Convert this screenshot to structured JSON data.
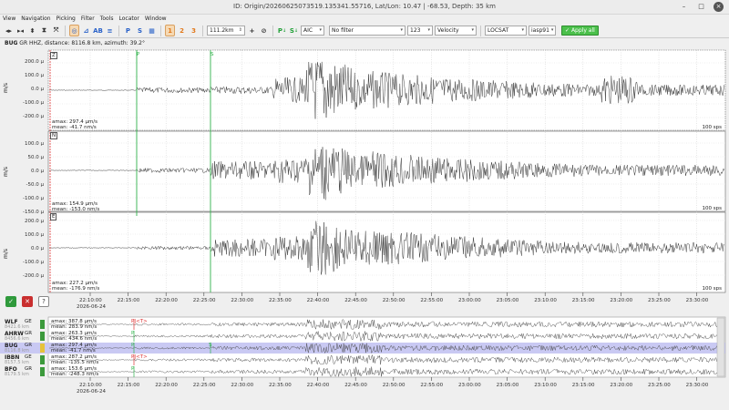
{
  "window": {
    "title": "ID: Origin/20260625073519.135341.55716, Lat/Lon: 10.47 | -68.53, Depth: 35 km"
  },
  "menu": [
    "View",
    "Navigation",
    "Picking",
    "Filter",
    "Tools",
    "Locator",
    "Window"
  ],
  "toolbar": {
    "distance": "111.2km",
    "picker": "AIC",
    "filter": "No filter",
    "components": "123",
    "unit": "Velocity",
    "locator": "LOCSAT",
    "profile": "iasp91",
    "apply": "Apply all",
    "pick_p": "P",
    "pick_s": "S",
    "comp_z": "1",
    "comp_n": "2",
    "comp_e": "3",
    "ab_label": "AB",
    "plus": "+"
  },
  "station_info": {
    "code": "BUG",
    "rest": "GR  HHZ, distance: 8116.8 km, azimuth: 39.2°"
  },
  "traces": [
    {
      "comp": "Z",
      "amax": "amax: 297.4 µm/s",
      "mean": "mean: -41.7 nm/s",
      "sps": "100 sps",
      "ticks": [
        "200.0 µ",
        "100.0 µ",
        "0.0 µ",
        "-100.0 µ",
        "-200.0 µ"
      ],
      "unit": "m/s"
    },
    {
      "comp": "N",
      "amax": "amax: 154.9 µm/s",
      "mean": "mean: -153.0 nm/s",
      "sps": "100 sps",
      "ticks": [
        "100.0 µ",
        "50.0 µ",
        "0.0 µ",
        "-50.0 µ",
        "-100.0 µ",
        "-150.0 µ"
      ],
      "unit": "m/s"
    },
    {
      "comp": "E",
      "amax": "amax: 227.2 µm/s",
      "mean": "mean: -176.9 nm/s",
      "sps": "100 sps",
      "ticks": [
        "200.0 µ",
        "100.0 µ",
        "0.0 µ",
        "-100.0 µ",
        "-200.0 µ"
      ],
      "unit": "m/s"
    }
  ],
  "time_axis": {
    "labels": [
      "22:10:00",
      "22:15:00",
      "22:20:00",
      "22:25:00",
      "22:30:00",
      "22:35:00",
      "22:40:00",
      "22:45:00",
      "22:50:00",
      "22:55:00",
      "23:00:00",
      "23:05:00",
      "23:10:00",
      "23:15:00",
      "23:20:00",
      "23:25:00",
      "23:30:00"
    ],
    "date": "2026-06-24"
  },
  "picks": {
    "p": "P",
    "s": "S"
  },
  "stations": [
    {
      "name": "WLF",
      "net": "GE",
      "dist": "8421.6 km",
      "amax": "amax: 387.8 µm/s",
      "mean": "mean: 283.9 nm/s",
      "pick": "P|<T>",
      "highlight": false
    },
    {
      "name": "AHRW",
      "net": "GR",
      "dist": "8456.6 km",
      "amax": "amax: 263.3 µm/s",
      "mean": "mean: 434.6 nm/s",
      "pick": "P",
      "highlight": false
    },
    {
      "name": "BUG",
      "net": "GR",
      "dist": "8116.8 km",
      "amax": "amax: 297.4 µm/s",
      "mean": "mean: -41.7 nm/s",
      "pick": "P",
      "highlight": true
    },
    {
      "name": "IBBN",
      "net": "GE",
      "dist": "8157.5 km",
      "amax": "amax: 287.2 µm/s",
      "mean": "mean: -135.5 nm/s",
      "pick": "P|<T>",
      "highlight": false
    },
    {
      "name": "BFO",
      "net": "GR",
      "dist": "8179.5 km",
      "amax": "amax: 153.6 µm/s",
      "mean": "mean: -248.3 nm/s",
      "pick": "P",
      "highlight": false
    }
  ],
  "colors": {
    "pick_p": "#2fb24a",
    "pick_s": "#2fb24a",
    "pick_t": "#d33",
    "highlight": "#c9c9f3",
    "trace": "#333333"
  }
}
